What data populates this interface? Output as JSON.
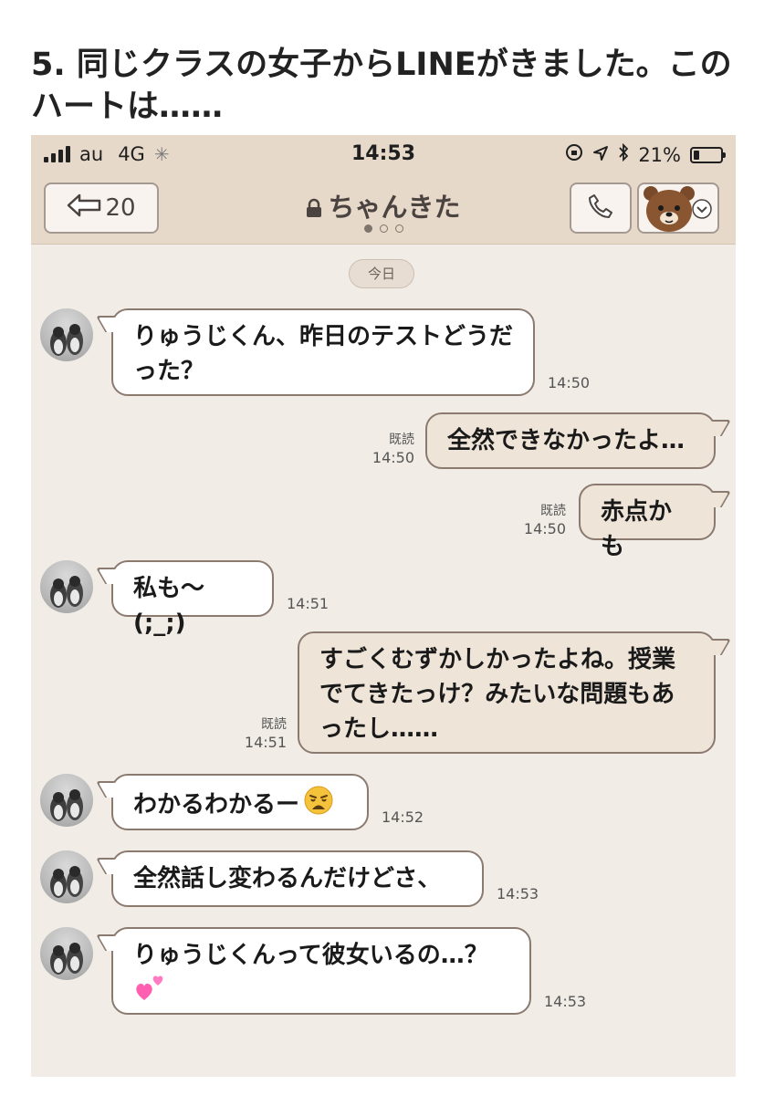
{
  "article": {
    "title": "5. 同じクラスの女子からLINEがきました。このハートは……"
  },
  "statusbar": {
    "carrier": "au",
    "network": "4G",
    "time": "14:53",
    "battery": "21%",
    "battery_level": 0.21
  },
  "navbar": {
    "back_count": "20",
    "chat_name": "ちゃんきた"
  },
  "date_separator": "今日",
  "messages": [
    {
      "side": "received",
      "text": "りゅうじくん、昨日のテストどうだった？",
      "time": "14:50"
    },
    {
      "side": "sent",
      "text": "全然できなかったよ…",
      "time": "14:50",
      "read_label": "既読"
    },
    {
      "side": "sent",
      "text": "赤点かも",
      "time": "14:50",
      "read_label": "既読"
    },
    {
      "side": "received",
      "text": "私も〜(;_;)",
      "time": "14:51"
    },
    {
      "side": "sent",
      "text": "すごくむずかしかったよね。授業でてきたっけ？みたいな問題もあったし……",
      "time": "14:51",
      "read_label": "既読"
    },
    {
      "side": "received",
      "text": "わかるわかるー",
      "emoji": "weary-face",
      "time": "14:52"
    },
    {
      "side": "received",
      "text": "全然話し変わるんだけどさ、",
      "time": "14:53"
    },
    {
      "side": "received",
      "text": "りゅうじくんって彼女いるの…？",
      "emoji": "two-hearts",
      "time": "14:53"
    }
  ]
}
